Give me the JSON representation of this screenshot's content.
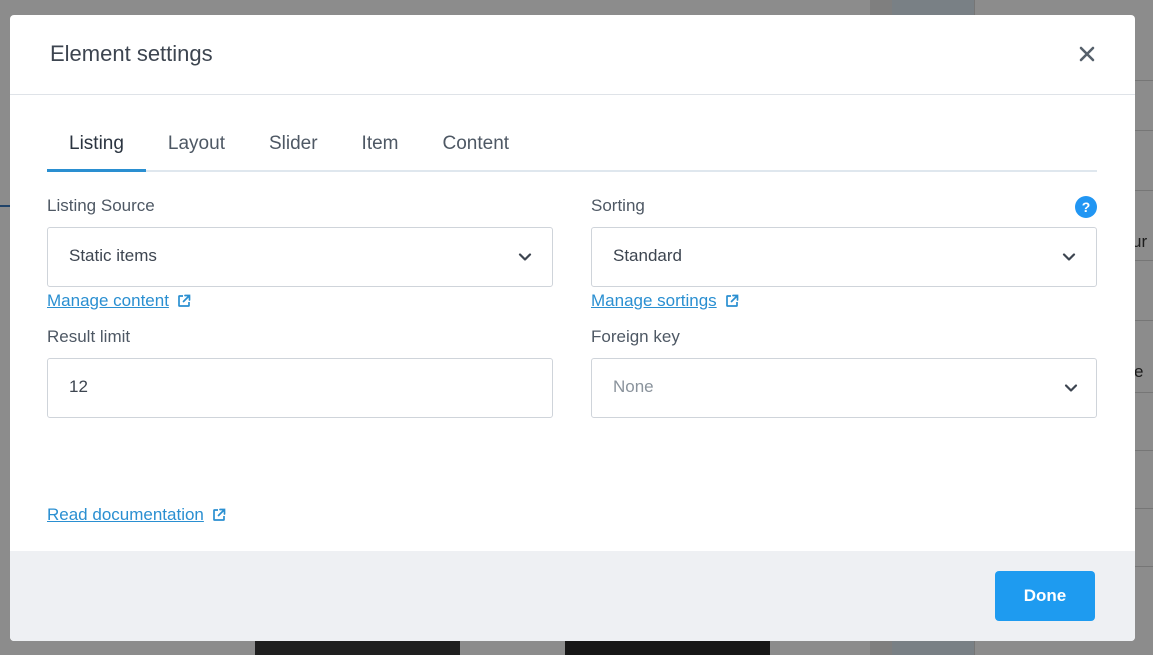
{
  "background": {
    "cell_text_1": "ur",
    "cell_text_2": "e"
  },
  "modal": {
    "title": "Element settings",
    "close_icon": "close-icon"
  },
  "tabs": [
    {
      "label": "Listing",
      "active": true
    },
    {
      "label": "Layout",
      "active": false
    },
    {
      "label": "Slider",
      "active": false
    },
    {
      "label": "Item",
      "active": false
    },
    {
      "label": "Content",
      "active": false
    }
  ],
  "listing_source": {
    "label": "Listing Source",
    "value": "Static items",
    "link": "Manage content"
  },
  "sorting": {
    "label": "Sorting",
    "value": "Standard",
    "link": "Manage sortings",
    "help": "?"
  },
  "result_limit": {
    "label": "Result limit",
    "value": "12"
  },
  "foreign_key": {
    "label": "Foreign key",
    "value": "None"
  },
  "documentation_link": "Read documentation",
  "footer": {
    "done_label": "Done"
  },
  "colors": {
    "accent": "#2a8fd1",
    "done_button": "#1e9bf0",
    "help_icon": "#2196f3",
    "footer_bg": "#eef0f3"
  }
}
